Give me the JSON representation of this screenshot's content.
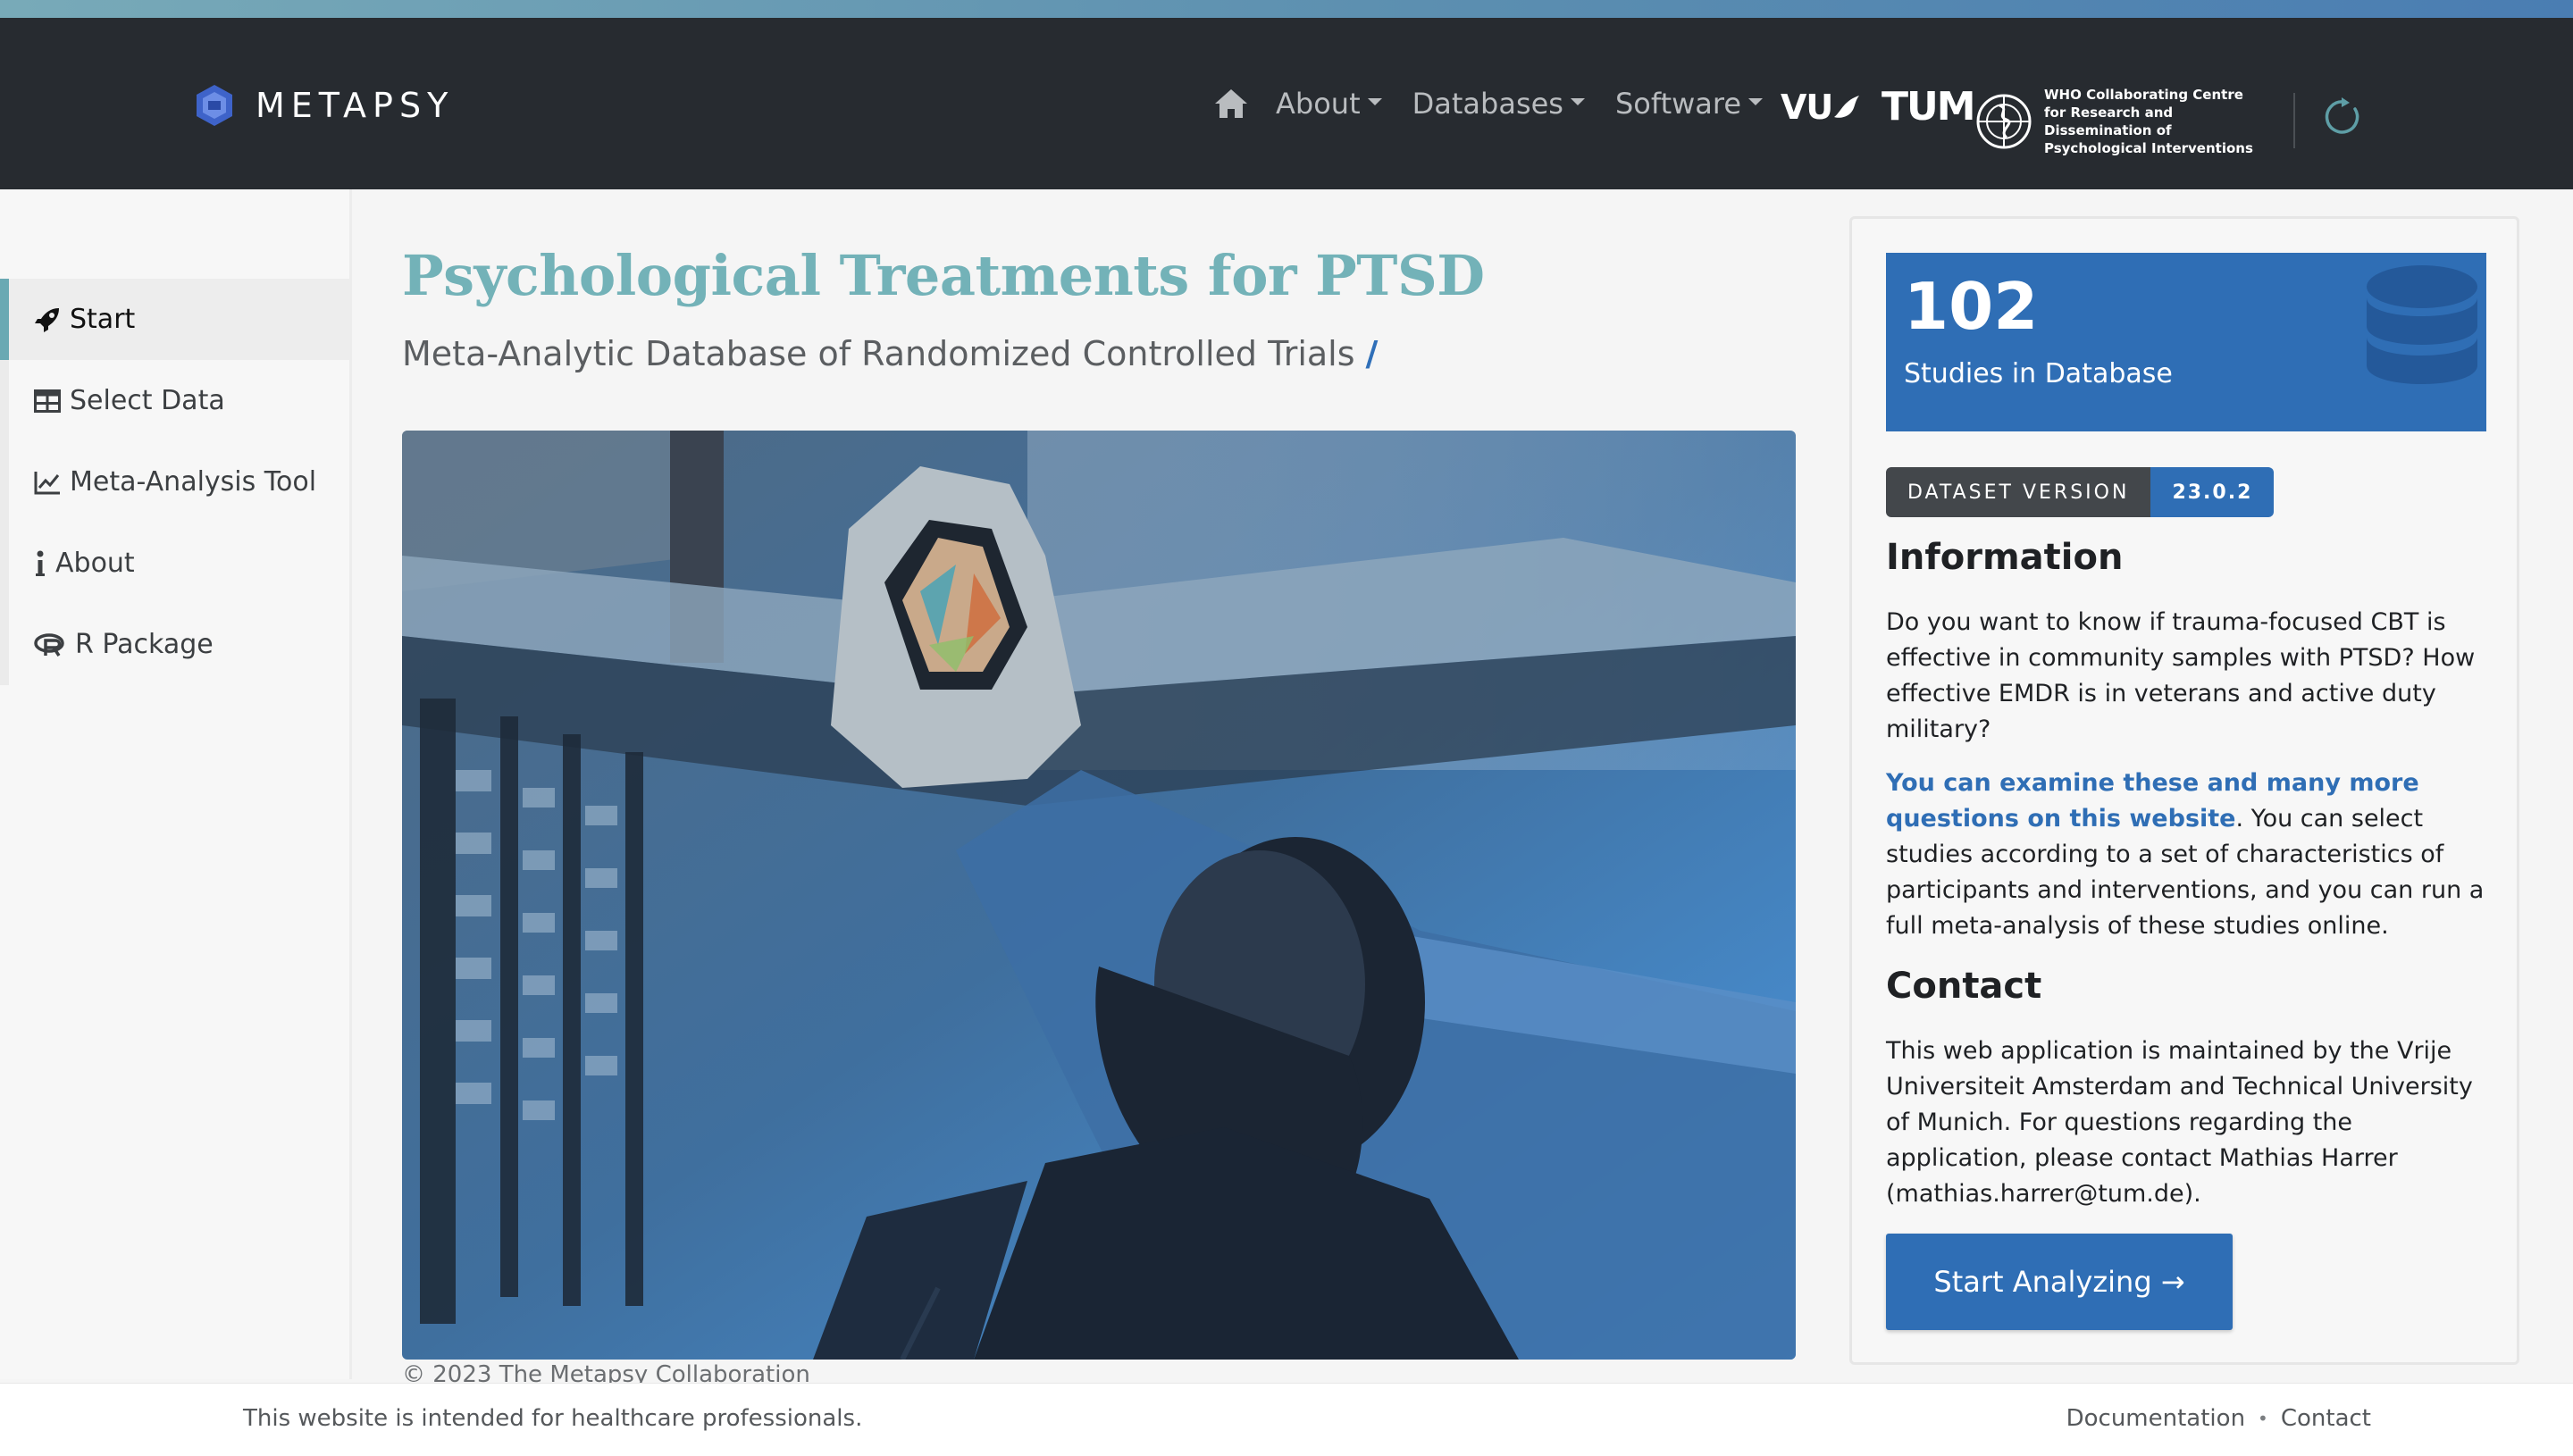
{
  "brand": {
    "name": "METAPSY"
  },
  "nav": {
    "items": [
      {
        "label": "About"
      },
      {
        "label": "Databases"
      },
      {
        "label": "Software"
      }
    ],
    "partners": {
      "vu": "VU",
      "tum": "TUM",
      "who_lines": [
        "WHO Collaborating Centre",
        "for Research and Dissemination of",
        "Psychological Interventions"
      ]
    }
  },
  "sidebar": {
    "items": [
      {
        "label": "Start",
        "icon": "rocket-icon"
      },
      {
        "label": "Select Data",
        "icon": "table-icon"
      },
      {
        "label": "Meta-Analysis Tool",
        "icon": "chart-line-icon"
      },
      {
        "label": "About",
        "icon": "info-icon"
      },
      {
        "label": "R Package",
        "icon": "r-project-icon"
      }
    ]
  },
  "main": {
    "title": "Psychological Treatments for PTSD",
    "subtitle": "Meta-Analytic Database of Randomized Controlled Trials",
    "subtitle_slash": "/",
    "copyright": "© 2023 The Metapsy Collaboration"
  },
  "card": {
    "study_count": "102",
    "study_label": "Studies in Database",
    "version_label": "DATASET VERSION",
    "version_value": "23.0.2",
    "info_title": "Information",
    "info_text": "Do you want to know if trauma-focused CBT is effective in community samples with PTSD? How effective EMDR is in veterans and active duty military?",
    "info_link": "You can examine these and many more questions on this website",
    "info_text2": ". You can select studies according to a set of characteristics of participants and interventions, and you can run a full meta-analysis of these studies online.",
    "contact_title": "Contact",
    "contact_text": "This web application is maintained by the Vrije Universiteit Amsterdam and Technical University of Munich. For questions regarding the application, please contact Mathias Harrer (mathias.harrer@tum.de).",
    "button_label": "Start Analyzing →"
  },
  "footer": {
    "notice": "This website is intended for healthcare professionals.",
    "links": [
      "Documentation",
      "Contact"
    ],
    "separator": "•"
  },
  "colors": {
    "navbar": "#272b30",
    "accent_teal": "#73b2b8",
    "accent_blue": "#2f6eb5"
  }
}
